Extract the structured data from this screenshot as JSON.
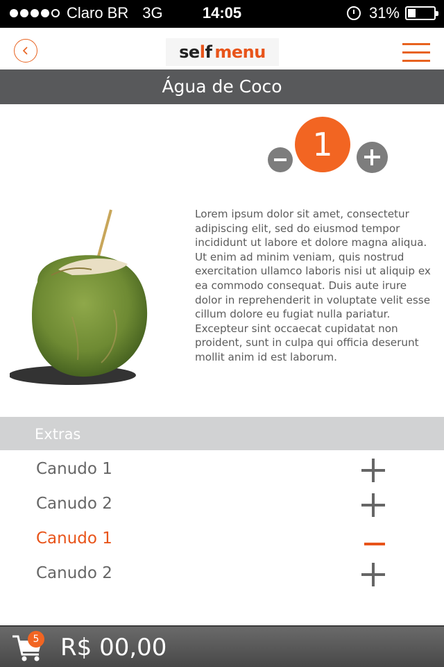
{
  "status_bar": {
    "carrier": "Claro BR",
    "network": "3G",
    "time": "14:05",
    "battery": "31%",
    "battery_level": 0.31
  },
  "header": {
    "logo_self": "se",
    "logo_l": "l",
    "logo_f": "f",
    "logo_menu": "menu"
  },
  "product": {
    "title": "Água de Coco",
    "quantity": "1",
    "description": "Lorem ipsum dolor sit amet, consectetur adipiscing elit, sed do eiusmod tempor incididunt ut labore et dolore magna aliqua. Ut enim ad minim veniam, quis nostrud exercitation ullamco laboris nisi ut aliquip ex ea commodo consequat. Duis aute irure dolor in reprehenderit in voluptate velit esse cillum dolore eu fugiat nulla pariatur. Excepteur sint occaecat cupidatat non proident, sunt in culpa qui officia deserunt mollit anim id est laborum."
  },
  "extras": {
    "header": "Extras",
    "items": [
      {
        "label": "Canudo 1",
        "action": "add"
      },
      {
        "label": "Canudo 2",
        "action": "add"
      },
      {
        "label": "Canudo 1",
        "action": "remove"
      },
      {
        "label": "Canudo 2",
        "action": "add"
      }
    ]
  },
  "cart": {
    "count": "5",
    "total": "R$ 00,00"
  },
  "colors": {
    "accent": "#f26522",
    "title_bar": "#58595b",
    "extras_header": "#d1d2d3"
  }
}
